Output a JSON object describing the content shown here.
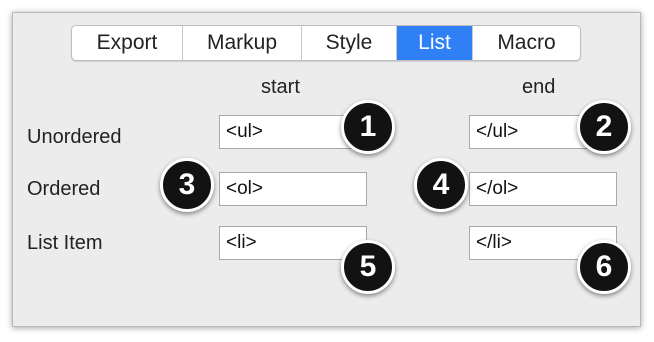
{
  "tabs": [
    {
      "label": "Export",
      "active": false
    },
    {
      "label": "Markup",
      "active": false
    },
    {
      "label": "Style",
      "active": false
    },
    {
      "label": "List",
      "active": true
    },
    {
      "label": "Macro",
      "active": false
    }
  ],
  "columns": {
    "start": "start",
    "end": "end"
  },
  "rows": [
    {
      "label": "Unordered",
      "start_value": "<ul>",
      "end_value": "</ul>"
    },
    {
      "label": "Ordered",
      "start_value": "<ol>",
      "end_value": "</ol>"
    },
    {
      "label": "List Item",
      "start_value": "<li>",
      "end_value": "</li>"
    }
  ],
  "badges": [
    "1",
    "2",
    "3",
    "4",
    "5",
    "6"
  ],
  "colors": {
    "accent": "#2f7ff5",
    "badge": "#121212",
    "panel": "#ececec"
  }
}
